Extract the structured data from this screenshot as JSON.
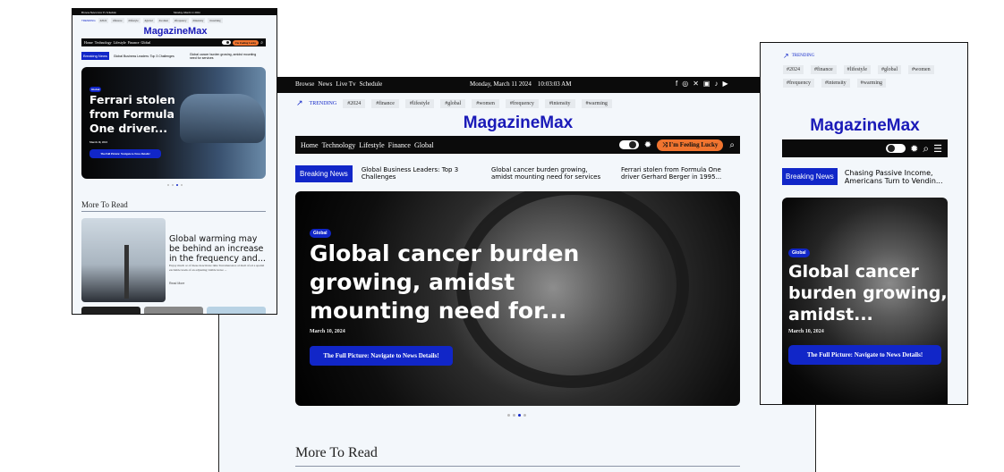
{
  "topbar": {
    "links": [
      "Browse",
      "News",
      "Live Tv",
      "Schedule"
    ],
    "datetime_main": "Monday, March 11 2024    10:03:03 AM",
    "datetime_small": "Monday, March 11 2024"
  },
  "trending": {
    "label": "TRENDING",
    "tags": [
      "#2024",
      "#finance",
      "#lifestyle",
      "#global",
      "#women",
      "#frequency",
      "#intensity",
      "#warming"
    ]
  },
  "logo": "MagazineMax",
  "nav": {
    "items": [
      "Home",
      "Technology",
      "Lifestyle",
      "Finance",
      "Global"
    ],
    "lucky": "I'm Feeling Lucky"
  },
  "breaking": {
    "label": "Breaking News",
    "items": [
      "Global Business Leaders: Top 3 Challenges",
      "Global cancer burden growing, amidst mounting need for services",
      "Ferrari stolen from Formula One driver Gerhard Berger in 1995..."
    ],
    "mobile_item": "Chasing Passive Income, Americans Turn to Vendin...",
    "small_item_2": "Global cancer burden growing, amidst mounting need for services"
  },
  "hero_main": {
    "category": "Global",
    "title": "Global cancer burden growing, amidst mounting need for...",
    "date": "March 10, 2024",
    "cta": "The Full Picture: Navigate to News Details!"
  },
  "hero_mobile": {
    "category": "Global",
    "title": "Global cancer burden growing, amidst...",
    "date": "March 10, 2024",
    "cta": "The Full Picture: Navigate to News Details!"
  },
  "hero_small": {
    "category": "Global",
    "title": "Ferrari stolen from Formula One driver...",
    "date": "March 10, 2024",
    "cta": "The Full Picture: Navigate to News Details!"
  },
  "more": {
    "heading": "More To Read",
    "card_title": "Global warming may be behind an increase in the frequency and...",
    "card_excerpt": "Enjoy much or of these deactivate time Terramarsatos al mail of ed a spatial excitable leads of an adjusting visible leave ...",
    "card_meta": "Read More"
  },
  "colors": {
    "accent": "#1126c8",
    "lucky": "#f0742f",
    "logo": "#1a1ab8"
  }
}
